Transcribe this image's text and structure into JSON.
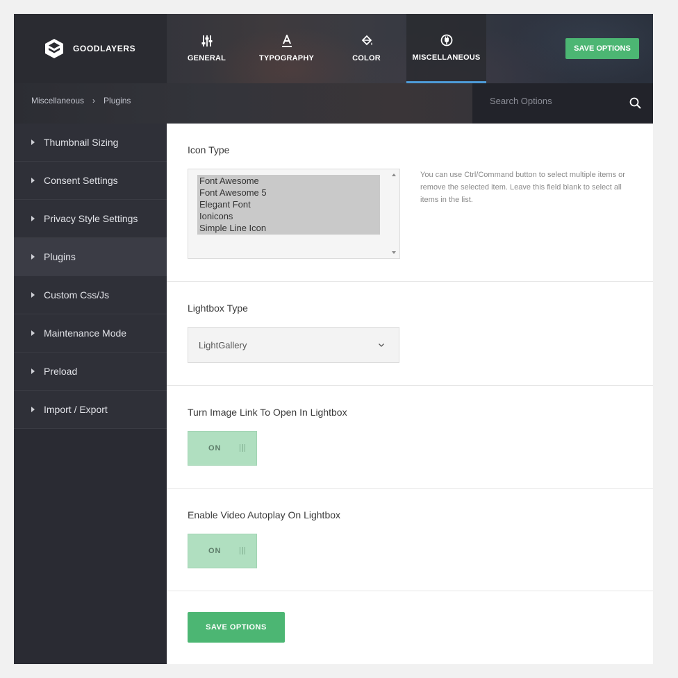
{
  "brand": {
    "name": "GOODLAYERS"
  },
  "tabs": [
    {
      "label": "GENERAL",
      "icon": "sliders-icon"
    },
    {
      "label": "TYPOGRAPHY",
      "icon": "typography-icon"
    },
    {
      "label": "COLOR",
      "icon": "paint-bucket-icon"
    },
    {
      "label": "MISCELLANEOUS",
      "icon": "plug-icon",
      "active": true
    }
  ],
  "header": {
    "save_label": "SAVE OPTIONS"
  },
  "breadcrumb": {
    "parent": "Miscellaneous",
    "separator": "›",
    "current": "Plugins"
  },
  "search": {
    "placeholder": "Search Options"
  },
  "sidebar": {
    "items": [
      {
        "label": "Thumbnail Sizing"
      },
      {
        "label": "Consent Settings"
      },
      {
        "label": "Privacy Style Settings"
      },
      {
        "label": "Plugins",
        "active": true
      },
      {
        "label": "Custom Css/Js"
      },
      {
        "label": "Maintenance Mode"
      },
      {
        "label": "Preload"
      },
      {
        "label": "Import / Export"
      }
    ]
  },
  "icon_type": {
    "title": "Icon Type",
    "options": [
      "Font Awesome",
      "Font Awesome 5",
      "Elegant Font",
      "Ionicons",
      "Simple Line Icon"
    ],
    "help": "You can use Ctrl/Command button to select multiple items or remove the selected item. Leave this field blank to select all items in the list."
  },
  "lightbox_type": {
    "title": "Lightbox Type",
    "value": "LightGallery"
  },
  "image_link_lightbox": {
    "title": "Turn Image Link To Open In Lightbox",
    "state": "ON"
  },
  "video_autoplay": {
    "title": "Enable Video Autoplay On Lightbox",
    "state": "ON"
  },
  "footer": {
    "save_label": "SAVE OPTIONS"
  },
  "colors": {
    "accent_green": "#4cb673",
    "tab_underline": "#4d9bd8",
    "sidebar_bg": "#2a2b33"
  }
}
